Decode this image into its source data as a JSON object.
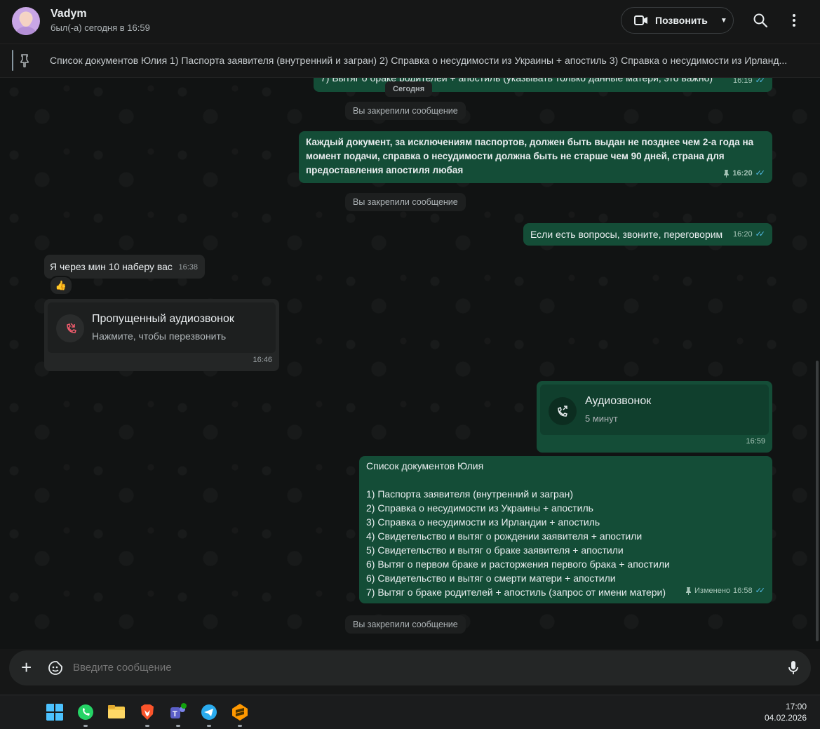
{
  "header": {
    "contact_name": "Vadym",
    "contact_status": "был(-а) сегодня в 16:59",
    "call_label": "Позвонить"
  },
  "pinned": {
    "text": "Список документов Юлия 1) Паспорта заявителя (внутренний и загран) 2) Справка о несудимости из Украины + апостиль 3) Справка о несудимости из Ирланд..."
  },
  "chat": {
    "partial_top": {
      "text": "7) Вытяг о браке родителей + апостиль (указывать только данные матери, это важно)",
      "time": "16:19"
    },
    "date_divider": "Сегодня",
    "sys1": "Вы закрепили сообщение",
    "msg1": {
      "text": "Каждый документ, за исключениям паспортов, должен быть выдан не позднее чем 2-а года на момент подачи, справка о несудимости должна быть не старше чем 90 дней, страна для предоставления апостиля любая",
      "time": "16:20"
    },
    "sys2": "Вы закрепили сообщение",
    "msg2": {
      "text": "Если есть вопросы, звоните, переговорим",
      "time": "16:20"
    },
    "msg3": {
      "text": "Я через мин 10 наберу вас",
      "time": "16:38",
      "reaction": "👍"
    },
    "missed_call": {
      "title": "Пропущенный аудиозвонок",
      "subtitle": "Нажмите, чтобы перезвонить",
      "time": "16:46"
    },
    "audio_call": {
      "title": "Аудиозвонок",
      "subtitle": "5 минут",
      "time": "16:59"
    },
    "doc_list": {
      "heading": "Список документов Юлия",
      "items": [
        "1) Паспорта заявителя (внутренний и загран)",
        "2) Справка о несудимости из Украины + апостиль",
        "3) Справка о несудимости из Ирландии + апостиль",
        "4) Свидетельство и вытяг о рождении заявителя + апостили",
        "5) Свидетельство и вытяг о браке заявителя + апостили",
        "6) Вытяг о первом браке и расторжения первого брака + апостили",
        "6) Свидетельство и вытяг о смерти матери + апостили",
        "7) Вытяг о браке родителей + апостиль (запрос от имени матери)"
      ],
      "edited_label": "Изменено",
      "time": "16:58"
    },
    "sys3": "Вы закрепили сообщение"
  },
  "composer": {
    "placeholder": "Введите сообщение"
  },
  "taskbar": {
    "apps": [
      "windows-start",
      "whatsapp",
      "file-explorer",
      "brave",
      "teams",
      "telegram",
      "sublime-text"
    ],
    "time": "17:00",
    "date": "04.02.2026"
  },
  "colors": {
    "outgoing_bubble": "#144d37",
    "incoming_bubble": "#242626",
    "read_ticks": "#53bdeb",
    "missed_call": "#f15c6d"
  }
}
